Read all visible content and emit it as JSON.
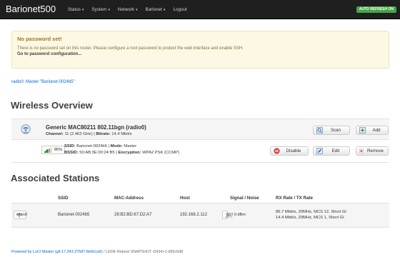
{
  "navbar": {
    "brand": "Barionet500",
    "items": [
      {
        "label": "Status"
      },
      {
        "label": "System"
      },
      {
        "label": "Network"
      },
      {
        "label": "Barionet"
      },
      {
        "label": "Logout"
      }
    ],
    "auto_refresh": "AUTO REFRESH ON"
  },
  "alert": {
    "title": "No password set!",
    "text": "There is no password set on this router. Please configure a root password to protect the web interface and enable SSH.",
    "link": "Go to password configuration..."
  },
  "radio_link": "radio0: Master \"Barionet-0024b5\"",
  "wireless": {
    "heading": "Wireless Overview",
    "device": {
      "title": "Generic MAC80211 802.11bgn (radio0)",
      "channel_label": "Channel:",
      "channel_value": "11 (2.462 GHz)",
      "bitrate_label": "Bitrate:",
      "bitrate_value": "14.4 Mbit/s",
      "scan_label": "Scan",
      "add_label": "Add"
    },
    "network": {
      "signal_percent": "85%",
      "signal_level": 0.85,
      "ssid_label": "SSID:",
      "ssid_value": "Barionet-0024b5",
      "mode_label": "Mode:",
      "mode_value": "Master",
      "bssid_label": "BSSID:",
      "bssid_value": "50:AB:3E:00:24:B5",
      "encryption_label": "Encryption:",
      "encryption_value": "WPA2 PSK (CCMP)",
      "disable_label": "Disable",
      "edit_label": "Edit",
      "remove_label": "Remove"
    }
  },
  "stations": {
    "heading": "Associated Stations",
    "columns": [
      "SSID",
      "MAC-Address",
      "Host",
      "Signal / Noise",
      "RX Rate / TX Rate"
    ],
    "rows": [
      {
        "iface": "wlan0",
        "ssid": "Barionet-0024b5",
        "mac": "28:B2:BD:67:D2:A7",
        "host": "192.168.2.112",
        "signal": "-50 / 0 dBm",
        "rx": "86.7 Mbit/s, 20MHz, MCS 12, Short GI",
        "tx": "14.4 Mbit/s, 20MHz, MCS 1, Short GI"
      }
    ]
  },
  "footer": {
    "link": "Powered by LuCI Master (git-17.343.27587-8e6b1a6)",
    "rest": " / LEDE Reboot SNAPSHOT r5434+1-d56c6d8"
  },
  "colors": {
    "navbar": "#1f1f1f",
    "alert_bg": "#fcf8e3",
    "link": "#0069d6",
    "auto_refresh": "#46a546"
  }
}
